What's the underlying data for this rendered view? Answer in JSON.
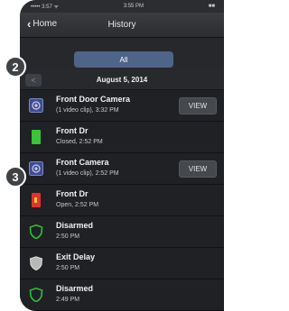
{
  "statusbar": {
    "carrier": "••••• 3:57 ᯤ",
    "time": "3:55 PM",
    "battery": "■■"
  },
  "nav": {
    "back_label": "Home",
    "title": "History"
  },
  "filter": {
    "selected": "All"
  },
  "date": {
    "prev_icon": "<",
    "label": "August 5, 2014"
  },
  "badges": {
    "first": "2",
    "second": "3"
  },
  "view_label": "VIEW",
  "events": [
    {
      "icon": "camera-icon",
      "title": "Front Door Camera",
      "subtitle": "(1 video clip), 3:32 PM",
      "has_view": true
    },
    {
      "icon": "door-closed-icon",
      "title": "Front Dr",
      "subtitle": "Closed, 2:52 PM",
      "has_view": false
    },
    {
      "icon": "camera-icon",
      "title": "Front Camera",
      "subtitle": "(1 video clip), 2:52 PM",
      "has_view": true
    },
    {
      "icon": "door-open-icon",
      "title": "Front Dr",
      "subtitle": "Open, 2:52 PM",
      "has_view": false
    },
    {
      "icon": "shield-disarmed-icon",
      "title": "Disarmed",
      "subtitle": "2:50 PM",
      "has_view": false
    },
    {
      "icon": "shield-delay-icon",
      "title": "Exit Delay",
      "subtitle": "2:50 PM",
      "has_view": false
    },
    {
      "icon": "shield-disarmed-icon",
      "title": "Disarmed",
      "subtitle": "2:49 PM",
      "has_view": false
    }
  ],
  "colors": {
    "accent": "#4e6489",
    "door_closed": "#3ac43a",
    "door_open": "#e0332c",
    "shield": "#2fbf3a"
  }
}
